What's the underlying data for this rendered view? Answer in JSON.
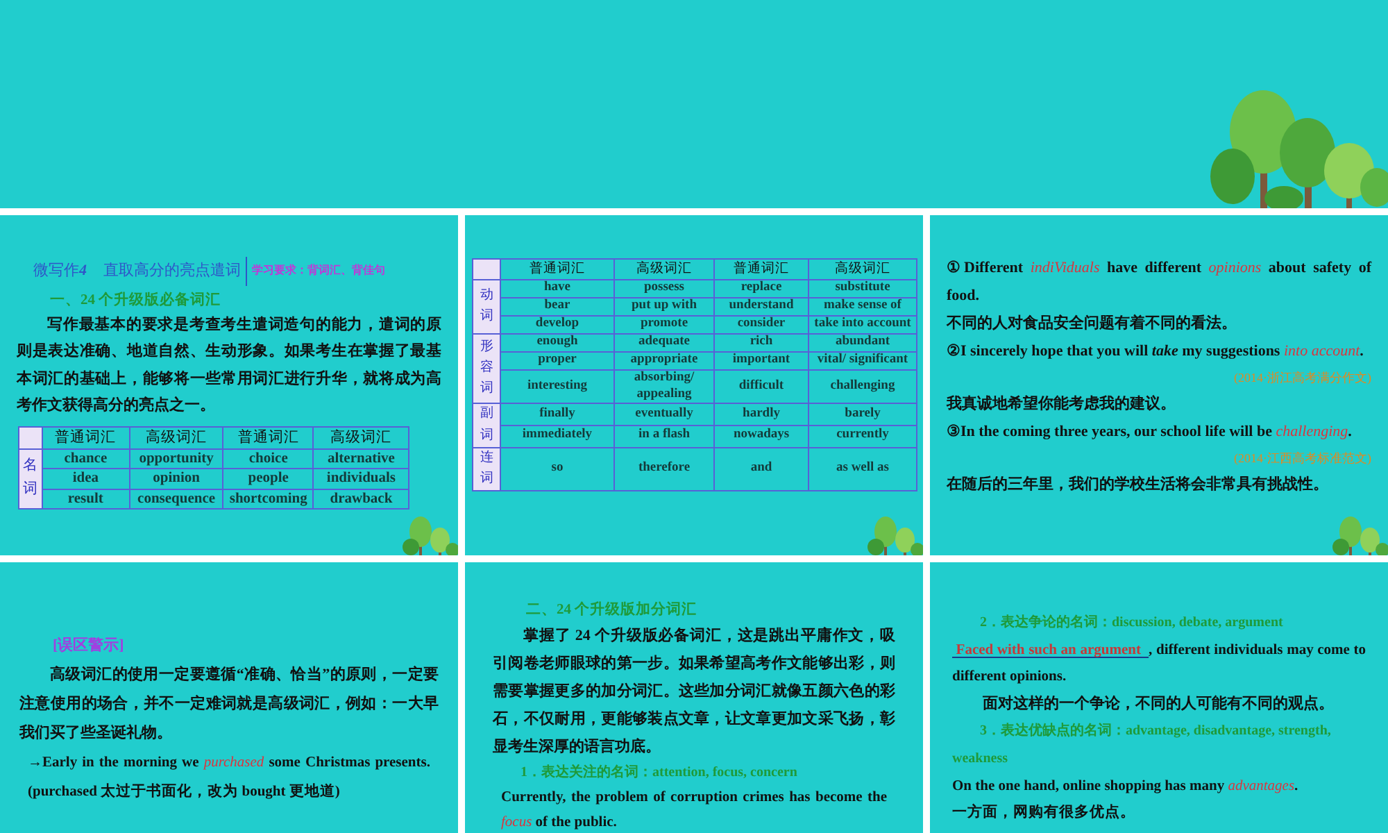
{
  "top_slide": {
    "tree_decoration": true
  },
  "slides": [
    {
      "tree_decoration": true,
      "blocks": [
        {
          "kind": "title",
          "label": "微写作",
          "number": "4",
          "text": "直取高分的亮点遣词",
          "note": "学习要求：背词汇、背佳句"
        },
        {
          "kind": "heading",
          "text": "一、24 个升级版必备词汇"
        },
        {
          "kind": "paragraph",
          "text": "写作最基本的要求是考查考生遣词造句的能力，遣词的原则是表达准确、地道自然、生动形象。如果考生在掌握了最基本词汇的基础上，能够将一些常用词汇进行升华，就将成为高考作文获得高分的亮点之一。"
        },
        {
          "kind": "table",
          "columns": [
            "普通词汇",
            "高级词汇",
            "普通词汇",
            "高级词汇"
          ],
          "groups": [
            {
              "label": "名词",
              "rows": [
                [
                  "chance",
                  "opportunity",
                  "choice",
                  "alternative"
                ],
                [
                  "idea",
                  "opinion",
                  "people",
                  "individuals"
                ],
                [
                  "result",
                  "consequence",
                  "shortcoming",
                  "drawback"
                ]
              ]
            }
          ]
        }
      ]
    },
    {
      "tree_decoration": true,
      "blocks": [
        {
          "kind": "table",
          "columns": [
            "普通词汇",
            "高级词汇",
            "普通词汇",
            "高级词汇"
          ],
          "groups": [
            {
              "label": "动词",
              "rows": [
                [
                  "have",
                  "possess",
                  "replace",
                  "substitute"
                ],
                [
                  "bear",
                  "put up with",
                  "understand",
                  "make sense of"
                ],
                [
                  "develop",
                  "promote",
                  "consider",
                  "take into account"
                ]
              ]
            },
            {
              "label": "形容词",
              "rows": [
                [
                  "enough",
                  "adequate",
                  "rich",
                  "abundant"
                ],
                [
                  "proper",
                  "appropriate",
                  "important",
                  "vital/ significant"
                ],
                [
                  "interesting",
                  "absorbing/ appealing",
                  "difficult",
                  "challenging"
                ]
              ]
            },
            {
              "label": "副词",
              "rows": [
                [
                  "finally",
                  "eventually",
                  "hardly",
                  "barely"
                ],
                [
                  "immediately",
                  "in a flash",
                  "nowadays",
                  "currently"
                ]
              ]
            },
            {
              "label": "连词",
              "rows": [
                [
                  "so",
                  "therefore",
                  "and",
                  "as well as"
                ]
              ]
            }
          ]
        }
      ]
    },
    {
      "tree_decoration": true,
      "blocks": [
        {
          "kind": "sentence",
          "text": "①Different **indiViduals** have different **opinions** about safety of food."
        },
        {
          "kind": "sentence",
          "text": "不同的人对食品安全问题有着不同的看法。"
        },
        {
          "kind": "sentence",
          "text": "②I sincerely hope that you will *take* my suggestions **into account**."
        },
        {
          "kind": "source",
          "text": "(2014·浙江高考满分作文)"
        },
        {
          "kind": "sentence",
          "text": "我真诚地希望你能考虑我的建议。"
        },
        {
          "kind": "sentence",
          "text": "③In the coming three years, our school life will be **challenging**."
        },
        {
          "kind": "source",
          "text": "(2014·江西高考标准范文)"
        },
        {
          "kind": "sentence",
          "text": "在随后的三年里，我们的学校生活将会非常具有挑战性。"
        }
      ]
    },
    {
      "tree_decoration": false,
      "blocks": [
        {
          "kind": "warning_label",
          "text": "[误区警示]"
        },
        {
          "kind": "paragraph",
          "text": "高级词汇的使用一定要遵循“准确、恰当”的原则，一定要注意使用的场合，并不一定难词就是高级词汇，例如：一大早我们买了些圣诞礼物。"
        },
        {
          "kind": "example",
          "text": "→Early in the morning we **purchased** some Christmas presents. (purchased 太过于书面化，改为 bought 更地道)"
        }
      ]
    },
    {
      "tree_decoration": false,
      "blocks": [
        {
          "kind": "heading",
          "text": "二、24 个升级版加分词汇"
        },
        {
          "kind": "paragraph",
          "text": "掌握了 24 个升级版必备词汇，这是跳出平庸作文，吸引阅卷老师眼球的第一步。如果希望高考作文能够出彩，则需要掌握更多的加分词汇。这些加分词汇就像五颜六色的彩石，不仅耐用，更能够装点文章，让文章更加文采飞扬，彰显考生深厚的语言功底。"
        },
        {
          "kind": "subheading",
          "text": "1．表达关注的名词：attention, focus, concern"
        },
        {
          "kind": "example",
          "text": "Currently, the problem of corruption crimes has become the **focus** of the public."
        }
      ]
    },
    {
      "tree_decoration": false,
      "blocks": [
        {
          "kind": "subheading",
          "text": "2．表达争论的名词：discussion, debate, argument"
        },
        {
          "kind": "fill_sentence",
          "answer": "Faced with such an argument",
          "text": ", different individuals may come to different opinions."
        },
        {
          "kind": "paragraph",
          "text": "面对这样的一个争论，不同的人可能有不同的观点。"
        },
        {
          "kind": "subheading",
          "text": "3．表达优缺点的名词：advantage, disadvantage, strength, weakness"
        },
        {
          "kind": "sentence",
          "text": "On the one hand, online shopping has many **advantages**."
        },
        {
          "kind": "sentence",
          "text": "一方面，网购有很多优点。"
        }
      ]
    }
  ]
}
